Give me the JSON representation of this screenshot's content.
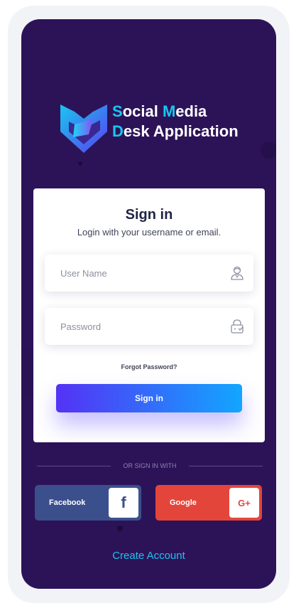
{
  "brand": {
    "line1_first": "S",
    "line1_rest": "ocial ",
    "line1_word2_first": "M",
    "line1_word2_rest": "edia",
    "line2_first": "D",
    "line2_rest": "esk Application",
    "accent_color": "#19c6f0"
  },
  "card": {
    "title": "Sign in",
    "subtitle": "Login with your username or email."
  },
  "fields": {
    "username_placeholder": "User Name",
    "password_placeholder": "Password",
    "username_icon": "user-icon",
    "password_icon": "lock-icon"
  },
  "links": {
    "forgot": "Forgot Password?",
    "create_account": "Create Account"
  },
  "buttons": {
    "signin": "Sign in"
  },
  "divider": {
    "text": "OR SIGN IN WITH"
  },
  "social": {
    "facebook_label": "Facebook",
    "facebook_glyph": "f",
    "google_label": "Google",
    "google_glyph": "G+"
  },
  "colors": {
    "background": "#2c1358",
    "facebook": "#3b4f8c",
    "google": "#e4453b",
    "gradient_start": "#5432f5",
    "gradient_end": "#12a6ff"
  }
}
